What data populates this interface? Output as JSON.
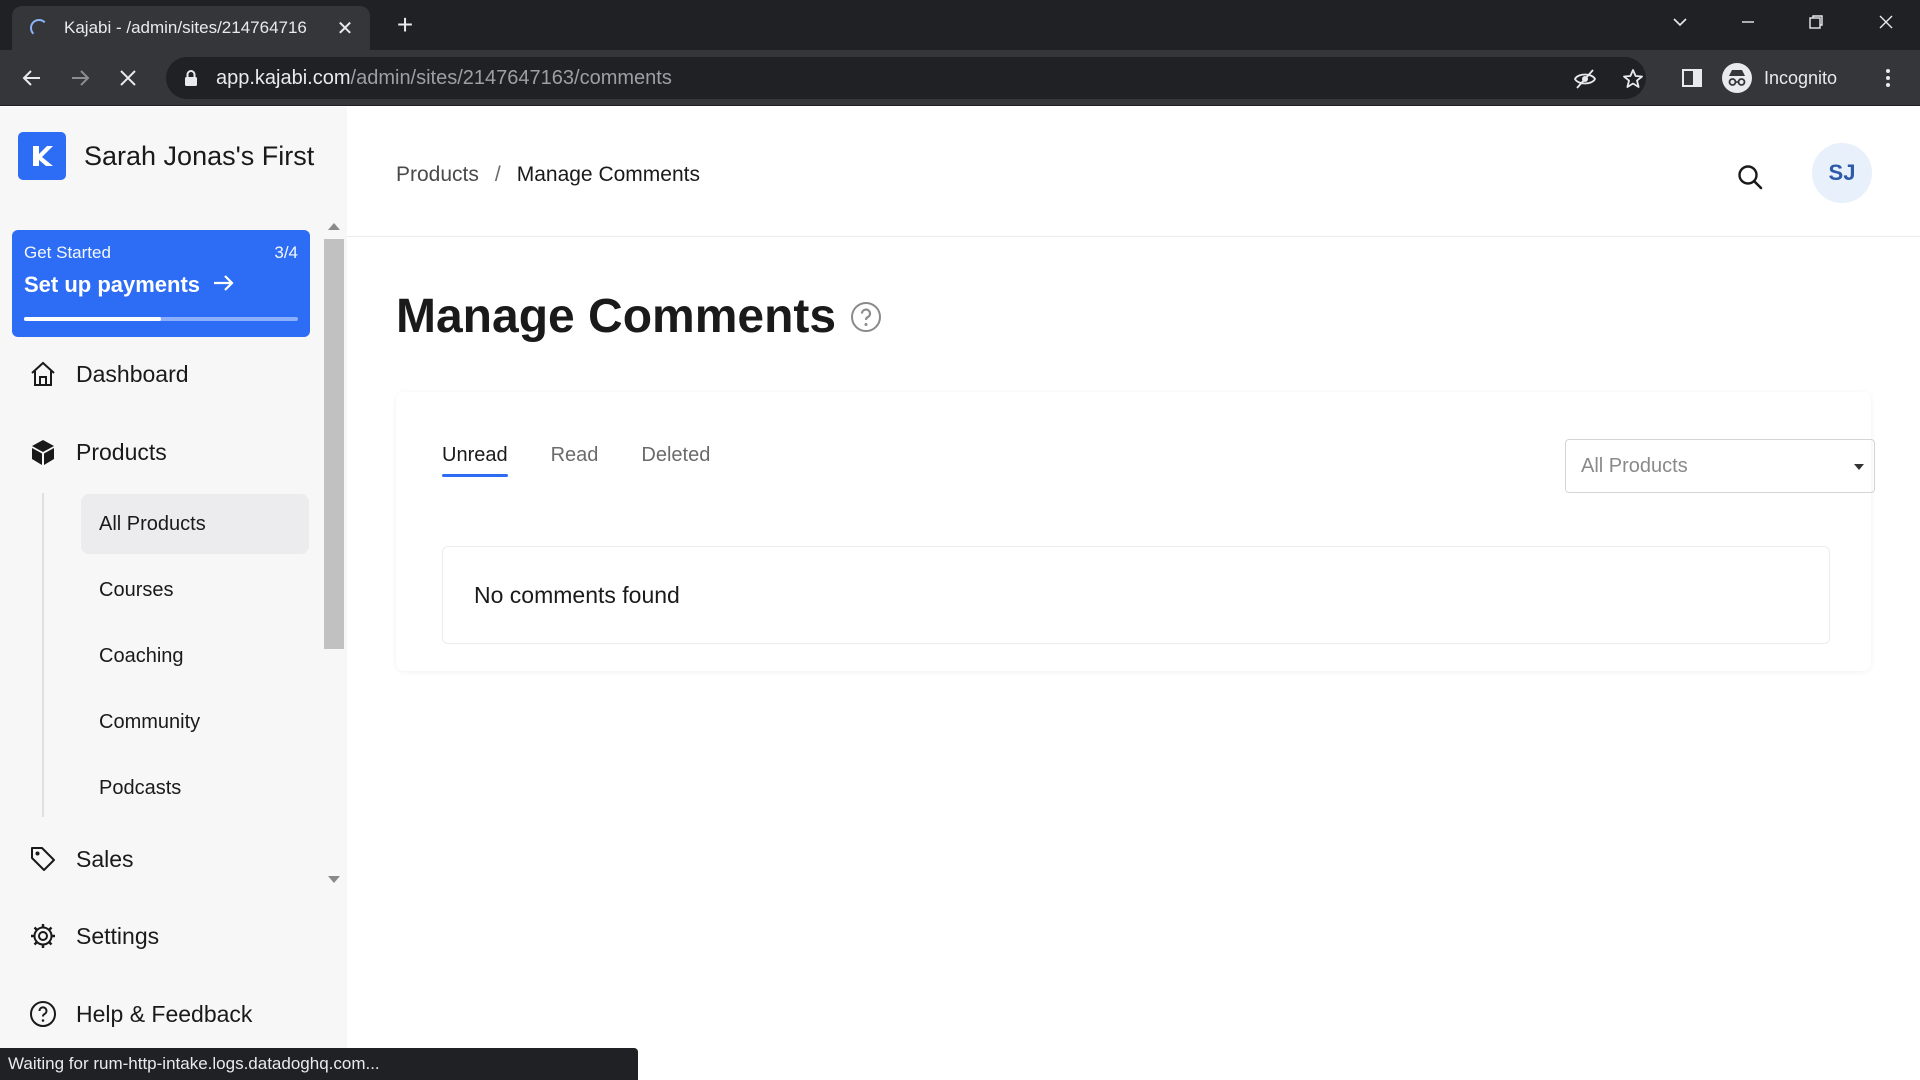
{
  "browser": {
    "tab_title": "Kajabi - /admin/sites/214764716",
    "url_host": "app.kajabi.com",
    "url_path": "/admin/sites/2147647163/comments",
    "profile_label": "Incognito",
    "status_text": "Waiting for rum-http-intake.logs.datadoghq.com..."
  },
  "sidebar": {
    "site_name": "Sarah Jonas's First",
    "get_started": {
      "label": "Get Started",
      "progress_text": "3/4",
      "progress_fraction": 0.5,
      "action": "Set up payments"
    },
    "nav": {
      "dashboard": "Dashboard",
      "products": "Products",
      "sales": "Sales",
      "settings": "Settings",
      "help": "Help & Feedback"
    },
    "sub_items": [
      "All Products",
      "Courses",
      "Coaching",
      "Community",
      "Podcasts"
    ],
    "active_sub_item": "All Products"
  },
  "header": {
    "breadcrumb_parent": "Products",
    "breadcrumb_separator": "/",
    "breadcrumb_current": "Manage Comments",
    "avatar_initials": "SJ"
  },
  "main": {
    "title": "Manage Comments",
    "tabs": [
      "Unread",
      "Read",
      "Deleted"
    ],
    "active_tab": "Unread",
    "product_filter": "All Products",
    "empty_message": "No comments found"
  },
  "colors": {
    "brand": "#2d6df6",
    "sidebar_bg": "#f7f7f8",
    "chrome_dark": "#202124",
    "chrome_toolbar": "#35363a"
  }
}
